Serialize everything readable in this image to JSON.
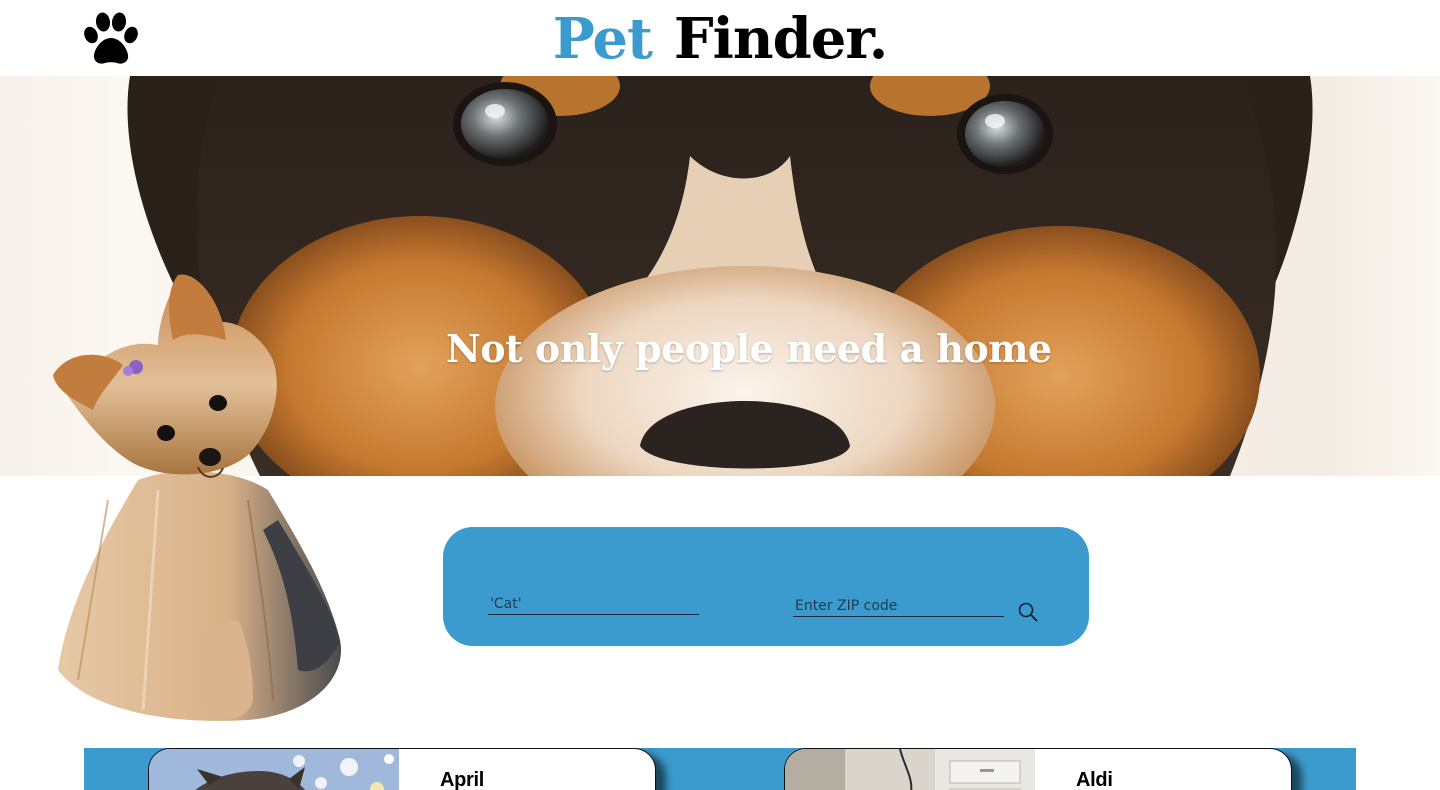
{
  "brand": {
    "word1": "Pet",
    "word2": "Finder.",
    "logo_icon": "paw-icon",
    "accent_color": "#3b9bce"
  },
  "hero": {
    "tagline": "Not only people need a home"
  },
  "search": {
    "pet_type_placeholder": "'Cat'",
    "zip_placeholder": "Enter ZIP code",
    "button_icon": "search-icon",
    "panel_color": "#3b9bce"
  },
  "results": {
    "cards": [
      {
        "name": "April"
      },
      {
        "name": "Aldi"
      }
    ]
  }
}
